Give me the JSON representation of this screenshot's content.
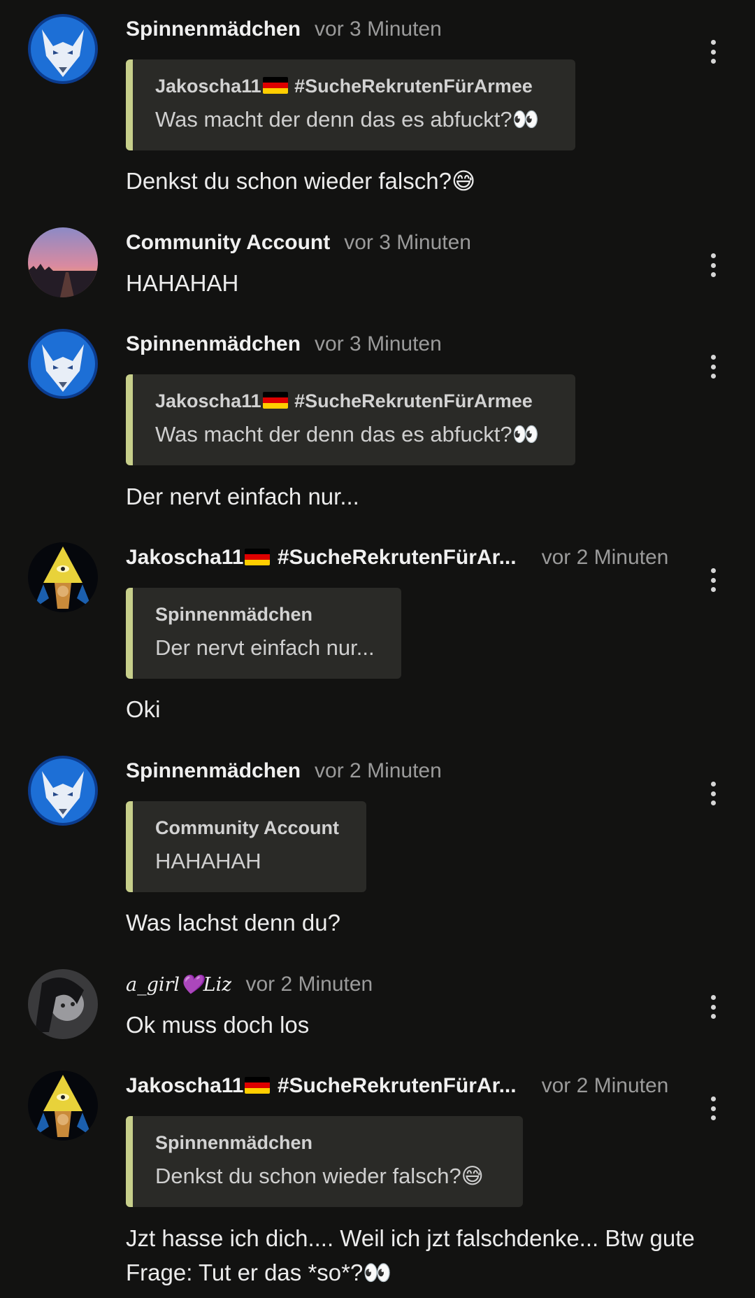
{
  "messages": [
    {
      "author": "Spinnenmädchen",
      "time": "vor 3 Minuten",
      "avatar_icon": "wolf-avatar-icon",
      "quote": {
        "author_name": "Jakoscha11",
        "author_tag": "#SucheRekrutenFürArmee",
        "text": "Was macht der denn das es abfuckt?👀"
      },
      "text": "Denkst du schon wieder falsch?😅"
    },
    {
      "author": "Community Account",
      "time": "vor 3 Minuten",
      "avatar_icon": "sunset-avatar-icon",
      "text": "HAHAHAH"
    },
    {
      "author": "Spinnenmädchen",
      "time": "vor 3 Minuten",
      "avatar_icon": "wolf-avatar-icon",
      "quote": {
        "author_name": "Jakoscha11",
        "author_tag": "#SucheRekrutenFürArmee",
        "text": "Was macht der denn das es abfuckt?👀"
      },
      "text": "Der nervt einfach nur..."
    },
    {
      "author_name": "Jakoscha11",
      "author_tag": "#SucheRekrutenFürAr...",
      "time": "vor 2 Minuten",
      "avatar_icon": "pyramid-avatar-icon",
      "quote": {
        "author": "Spinnenmädchen",
        "text": "Der nervt einfach nur..."
      },
      "text": "Oki"
    },
    {
      "author": "Spinnenmädchen",
      "time": "vor 2 Minuten",
      "avatar_icon": "wolf-avatar-icon",
      "quote": {
        "author": "Community Account",
        "text": "HAHAHAH"
      },
      "text": "Was lachst denn du?"
    },
    {
      "author": "a_girl💜Liz",
      "time": "vor 2 Minuten",
      "avatar_icon": "girl-avatar-icon",
      "text": "Ok muss doch los"
    },
    {
      "author_name": "Jakoscha11",
      "author_tag": "#SucheRekrutenFürAr...",
      "time": "vor 2 Minuten",
      "avatar_icon": "pyramid-avatar-icon",
      "quote": {
        "author": "Spinnenmädchen",
        "text": "Denkst du schon wieder falsch?😅"
      },
      "text": "Jzt hasse ich dich.... Weil ich jzt falschdenke... Btw gute Frage: Tut er das *so*?👀"
    }
  ],
  "icons": {
    "menu": "more-vertical-icon",
    "flag": "germany-flag-icon"
  },
  "colors": {
    "background": "#121211",
    "quote_background": "#2a2a27",
    "quote_accent": "#c7cf8b",
    "timestamp": "#9b9b9b"
  }
}
